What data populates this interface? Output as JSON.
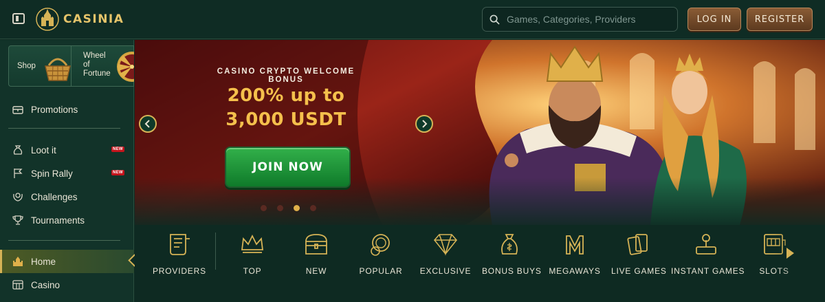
{
  "header": {
    "brand": "CASINIA",
    "search_placeholder": "Games, Categories, Providers",
    "login_label": "LOG IN",
    "register_label": "REGISTER"
  },
  "sidebar": {
    "tiles": [
      {
        "label": "Shop",
        "icon": "basket-icon"
      },
      {
        "label": "Wheel of Fortune",
        "icon": "wheel-icon"
      }
    ],
    "items": [
      {
        "label": "Promotions",
        "icon": "chest-icon",
        "badge": ""
      },
      {
        "label": "Loot it",
        "icon": "bag-icon",
        "badge": "NEW"
      },
      {
        "label": "Spin Rally",
        "icon": "flag-icon",
        "badge": "NEW"
      },
      {
        "label": "Challenges",
        "icon": "laurel-icon",
        "badge": ""
      },
      {
        "label": "Tournaments",
        "icon": "trophy-icon",
        "badge": ""
      },
      {
        "label": "Home",
        "icon": "castle-icon",
        "badge": ""
      },
      {
        "label": "Casino",
        "icon": "slot-icon",
        "badge": ""
      }
    ]
  },
  "banner": {
    "kicker": "CASINO CRYPTO WELCOME BONUS",
    "line1": "200% up to",
    "line2": "3,000 USDT",
    "cta": "JOIN NOW",
    "active_slide": 3,
    "slide_count": 4
  },
  "categories": [
    {
      "label": "PROVIDERS",
      "icon": "scroll-icon"
    },
    {
      "label": "TOP",
      "icon": "crown-icon"
    },
    {
      "label": "NEW",
      "icon": "treasure-chest-icon"
    },
    {
      "label": "POPULAR",
      "icon": "coins-icon"
    },
    {
      "label": "EXCLUSIVE",
      "icon": "diamond-icon"
    },
    {
      "label": "BONUS BUYS",
      "icon": "money-bag-icon"
    },
    {
      "label": "MEGAWAYS",
      "icon": "megaways-icon"
    },
    {
      "label": "LIVE GAMES",
      "icon": "cards-icon"
    },
    {
      "label": "INSTANT GAMES",
      "icon": "joystick-icon"
    },
    {
      "label": "SLOTS",
      "icon": "slot-machine-icon"
    }
  ],
  "colors": {
    "background": "#0e2a22",
    "gold": "#d6b356",
    "cta_green": "#1f9a3a",
    "badge_red": "#c4141c"
  }
}
